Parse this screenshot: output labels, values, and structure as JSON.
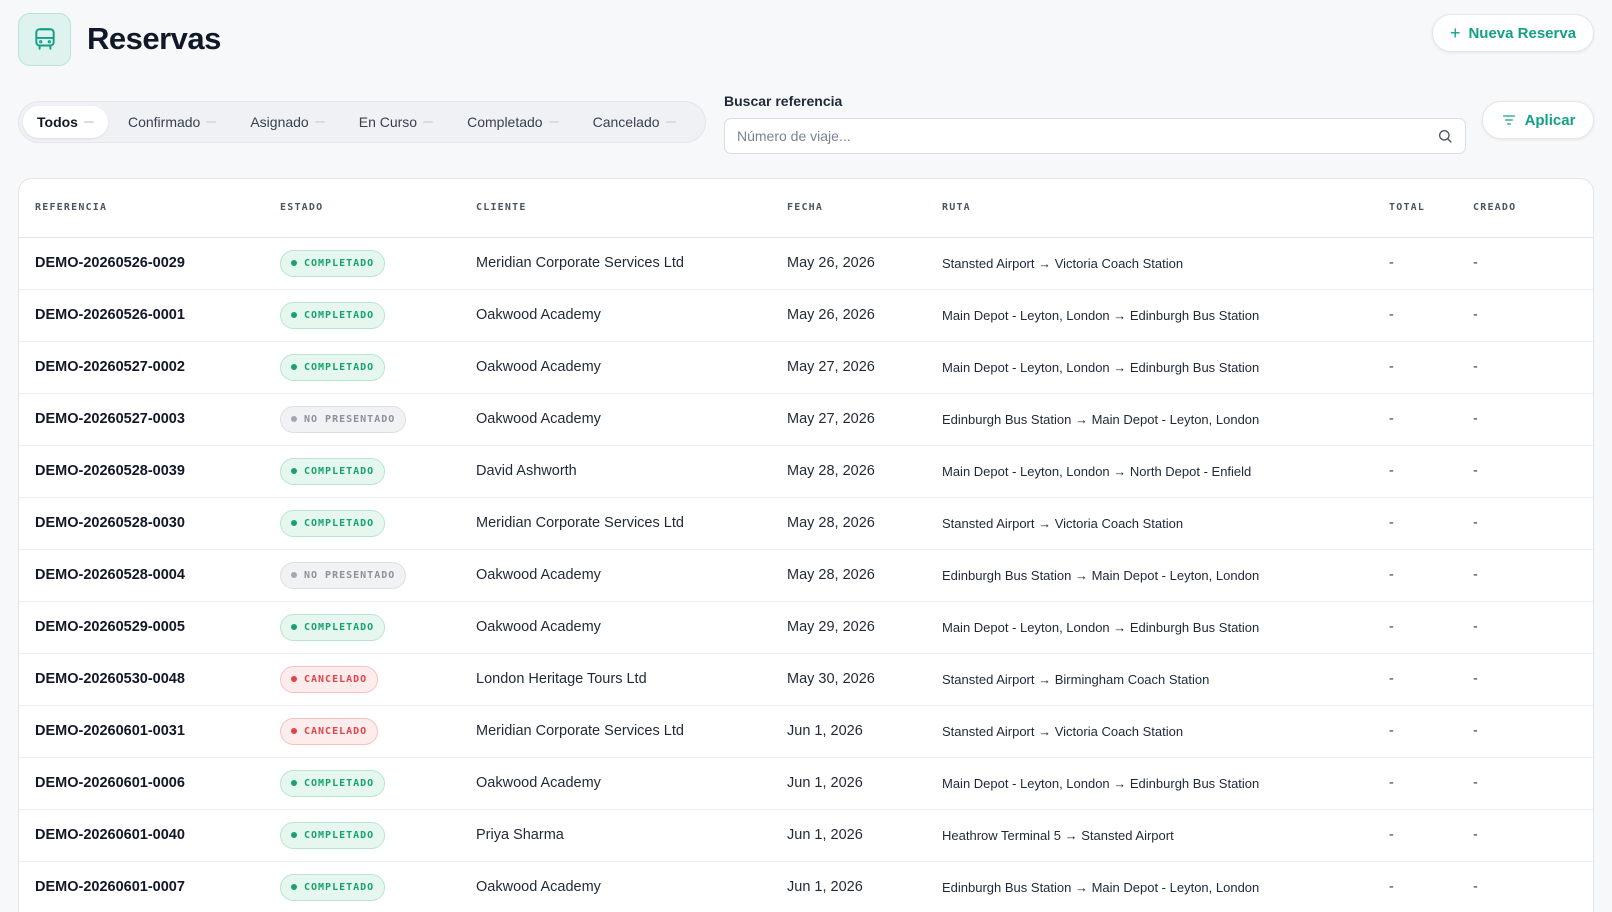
{
  "header": {
    "title": "Reservas",
    "icon": "bus-icon",
    "new_button_label": "Nueva Reserva"
  },
  "filters": {
    "tabs": [
      {
        "label": "Todos",
        "active": true
      },
      {
        "label": "Confirmado",
        "active": false
      },
      {
        "label": "Asignado",
        "active": false
      },
      {
        "label": "En Curso",
        "active": false
      },
      {
        "label": "Completado",
        "active": false
      },
      {
        "label": "Cancelado",
        "active": false
      }
    ],
    "search_label": "Buscar referencia",
    "search_placeholder": "Número de viaje...",
    "search_value": "",
    "apply_label": "Aplicar"
  },
  "colors": {
    "accent": "#14a085",
    "status_completed": "#16a36b",
    "status_no_show": "#8a919c",
    "status_cancelled": "#e0444a"
  },
  "table": {
    "columns": [
      "REFERENCIA",
      "ESTADO",
      "CLIENTE",
      "FECHA",
      "RUTA",
      "TOTAL",
      "CREADO"
    ],
    "rows": [
      {
        "ref": "DEMO-20260526-0029",
        "status": "COMPLETADO",
        "status_kind": "green",
        "client": "Meridian Corporate Services Ltd",
        "date": "May 26, 2026",
        "route": "Stansted Airport → Victoria Coach Station",
        "total": "-",
        "created": "-"
      },
      {
        "ref": "DEMO-20260526-0001",
        "status": "COMPLETADO",
        "status_kind": "green",
        "client": "Oakwood Academy",
        "date": "May 26, 2026",
        "route": "Main Depot - Leyton, London → Edinburgh Bus Station",
        "total": "-",
        "created": "-"
      },
      {
        "ref": "DEMO-20260527-0002",
        "status": "COMPLETADO",
        "status_kind": "green",
        "client": "Oakwood Academy",
        "date": "May 27, 2026",
        "route": "Main Depot - Leyton, London → Edinburgh Bus Station",
        "total": "-",
        "created": "-"
      },
      {
        "ref": "DEMO-20260527-0003",
        "status": "NO PRESENTADO",
        "status_kind": "gray",
        "client": "Oakwood Academy",
        "date": "May 27, 2026",
        "route": "Edinburgh Bus Station → Main Depot - Leyton, London",
        "total": "-",
        "created": "-"
      },
      {
        "ref": "DEMO-20260528-0039",
        "status": "COMPLETADO",
        "status_kind": "green",
        "client": "David Ashworth",
        "date": "May 28, 2026",
        "route": "Main Depot - Leyton, London → North Depot - Enfield",
        "total": "-",
        "created": "-"
      },
      {
        "ref": "DEMO-20260528-0030",
        "status": "COMPLETADO",
        "status_kind": "green",
        "client": "Meridian Corporate Services Ltd",
        "date": "May 28, 2026",
        "route": "Stansted Airport → Victoria Coach Station",
        "total": "-",
        "created": "-"
      },
      {
        "ref": "DEMO-20260528-0004",
        "status": "NO PRESENTADO",
        "status_kind": "gray",
        "client": "Oakwood Academy",
        "date": "May 28, 2026",
        "route": "Edinburgh Bus Station → Main Depot - Leyton, London",
        "total": "-",
        "created": "-"
      },
      {
        "ref": "DEMO-20260529-0005",
        "status": "COMPLETADO",
        "status_kind": "green",
        "client": "Oakwood Academy",
        "date": "May 29, 2026",
        "route": "Main Depot - Leyton, London → Edinburgh Bus Station",
        "total": "-",
        "created": "-"
      },
      {
        "ref": "DEMO-20260530-0048",
        "status": "CANCELADO",
        "status_kind": "red",
        "client": "London Heritage Tours Ltd",
        "date": "May 30, 2026",
        "route": "Stansted Airport → Birmingham Coach Station",
        "total": "-",
        "created": "-"
      },
      {
        "ref": "DEMO-20260601-0031",
        "status": "CANCELADO",
        "status_kind": "red",
        "client": "Meridian Corporate Services Ltd",
        "date": "Jun 1, 2026",
        "route": "Stansted Airport → Victoria Coach Station",
        "total": "-",
        "created": "-"
      },
      {
        "ref": "DEMO-20260601-0006",
        "status": "COMPLETADO",
        "status_kind": "green",
        "client": "Oakwood Academy",
        "date": "Jun 1, 2026",
        "route": "Main Depot - Leyton, London → Edinburgh Bus Station",
        "total": "-",
        "created": "-"
      },
      {
        "ref": "DEMO-20260601-0040",
        "status": "COMPLETADO",
        "status_kind": "green",
        "client": "Priya Sharma",
        "date": "Jun 1, 2026",
        "route": "Heathrow Terminal 5 → Stansted Airport",
        "total": "-",
        "created": "-"
      },
      {
        "ref": "DEMO-20260601-0007",
        "status": "COMPLETADO",
        "status_kind": "green",
        "client": "Oakwood Academy",
        "date": "Jun 1, 2026",
        "route": "Edinburgh Bus Station → Main Depot - Leyton, London",
        "total": "-",
        "created": "-"
      }
    ]
  }
}
